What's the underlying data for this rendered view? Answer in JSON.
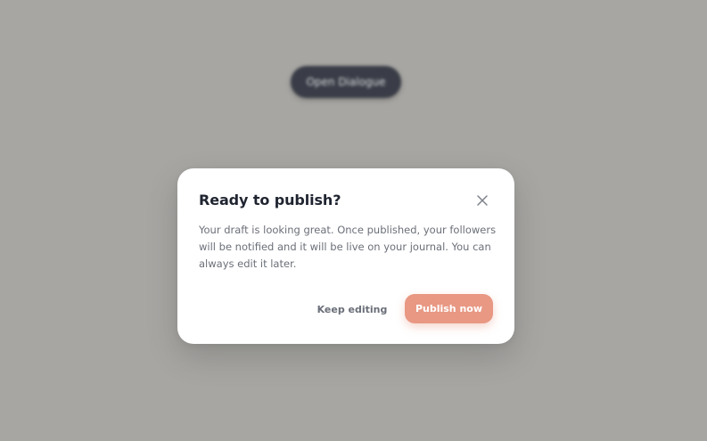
{
  "background": {
    "open_dialog_label": "Open Dialogue"
  },
  "dialog": {
    "title": "Ready to publish?",
    "close_icon": "close-icon",
    "body": "Your draft is looking great. Once published, your followers will be notified and it will be live on your journal. You can always edit it later.",
    "secondary_action": "Keep editing",
    "primary_action": "Publish now"
  },
  "colors": {
    "backdrop": "#a7a6a3",
    "background_button": "#3a3d47",
    "primary_button": "#e89883",
    "title_text": "#1f2430",
    "body_text": "#6b6f78"
  }
}
